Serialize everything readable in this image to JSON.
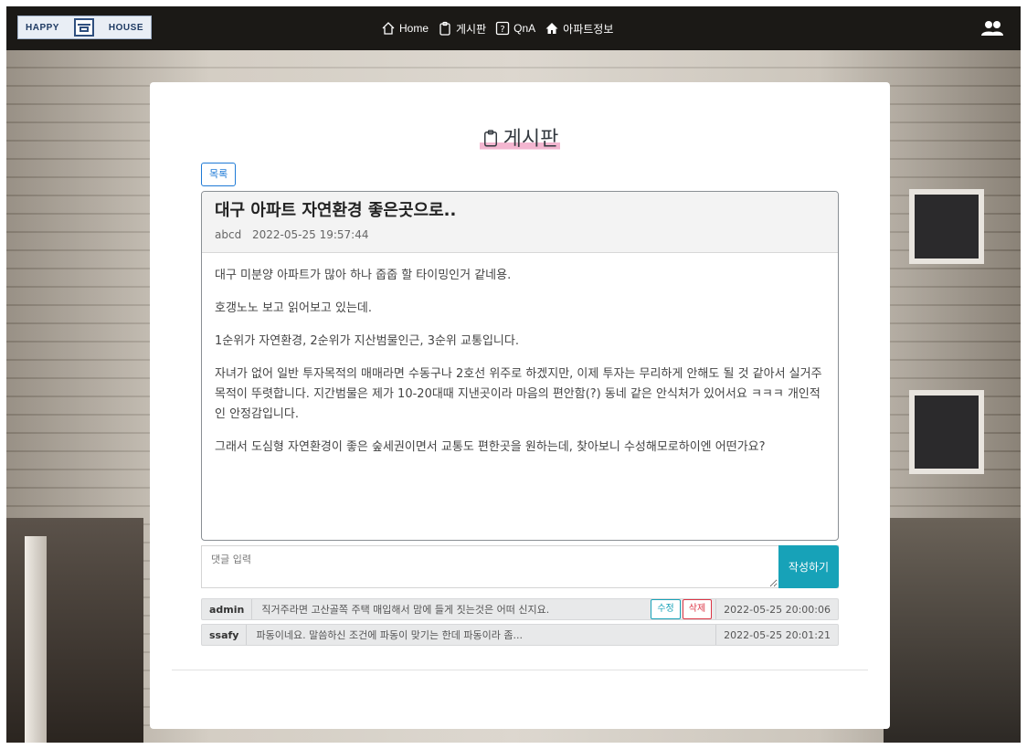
{
  "nav": {
    "logo_left": "HAPPY",
    "logo_right": "HOUSE",
    "items": [
      {
        "label": "Home",
        "icon": "home-icon"
      },
      {
        "label": "게시판",
        "icon": "clipboard-icon"
      },
      {
        "label": "QnA",
        "icon": "question-icon"
      },
      {
        "label": "아파트정보",
        "icon": "house-icon"
      }
    ],
    "user_icon": "users-icon"
  },
  "page": {
    "title": "게시판",
    "list_button": "목록"
  },
  "post": {
    "title": "대구 아파트 자연환경 좋은곳으로..",
    "author": "abcd",
    "date": "2022-05-25 19:57:44",
    "paragraphs": [
      "대구 미분양 아파트가 많아 하나 줍줍 할 타이밍인거 같네용.",
      "호갱노노 보고 읽어보고 있는데.",
      "1순위가 자연환경, 2순위가 지산범물인근, 3순위 교통입니다.",
      "자녀가 없어 일반 투자목적의 매매라면 수동구나 2호선 위주로 하겠지만, 이제 투자는 무리하게 안해도 될 것 같아서 실거주 목적이 뚜렷합니다. 지간범물은 제가 10-20대때 지낸곳이라 마음의 편안함(?) 동네 같은 안식처가 있어서요 ㅋㅋㅋ 개인적인 안정감입니다.",
      "그래서 도심형 자연환경이 좋은 숲세권이면서 교통도 편한곳을 원하는데, 찾아보니 수성해모로하이엔 어떤가요?"
    ]
  },
  "comment_form": {
    "placeholder": "댓글 입력",
    "submit_label": "작성하기"
  },
  "comments": [
    {
      "user": "admin",
      "text": "직거주라면 고산골쪽 주택 매입해서 맘에 들게 짓는것은 어떠 신지요.",
      "edit_label": "수정",
      "delete_label": "삭제",
      "date": "2022-05-25 20:00:06"
    },
    {
      "user": "ssafy",
      "text": "파동이네요. 말씀하신 조건에 파동이 맞기는 한데 파동이라 좀...",
      "date": "2022-05-25 20:01:21"
    }
  ],
  "colors": {
    "navbar": "#1b1916",
    "accent": "#17a2b8",
    "primary_outline": "#1e7ad6",
    "danger": "#dc3545",
    "title_highlight": "#f3b6d0"
  }
}
